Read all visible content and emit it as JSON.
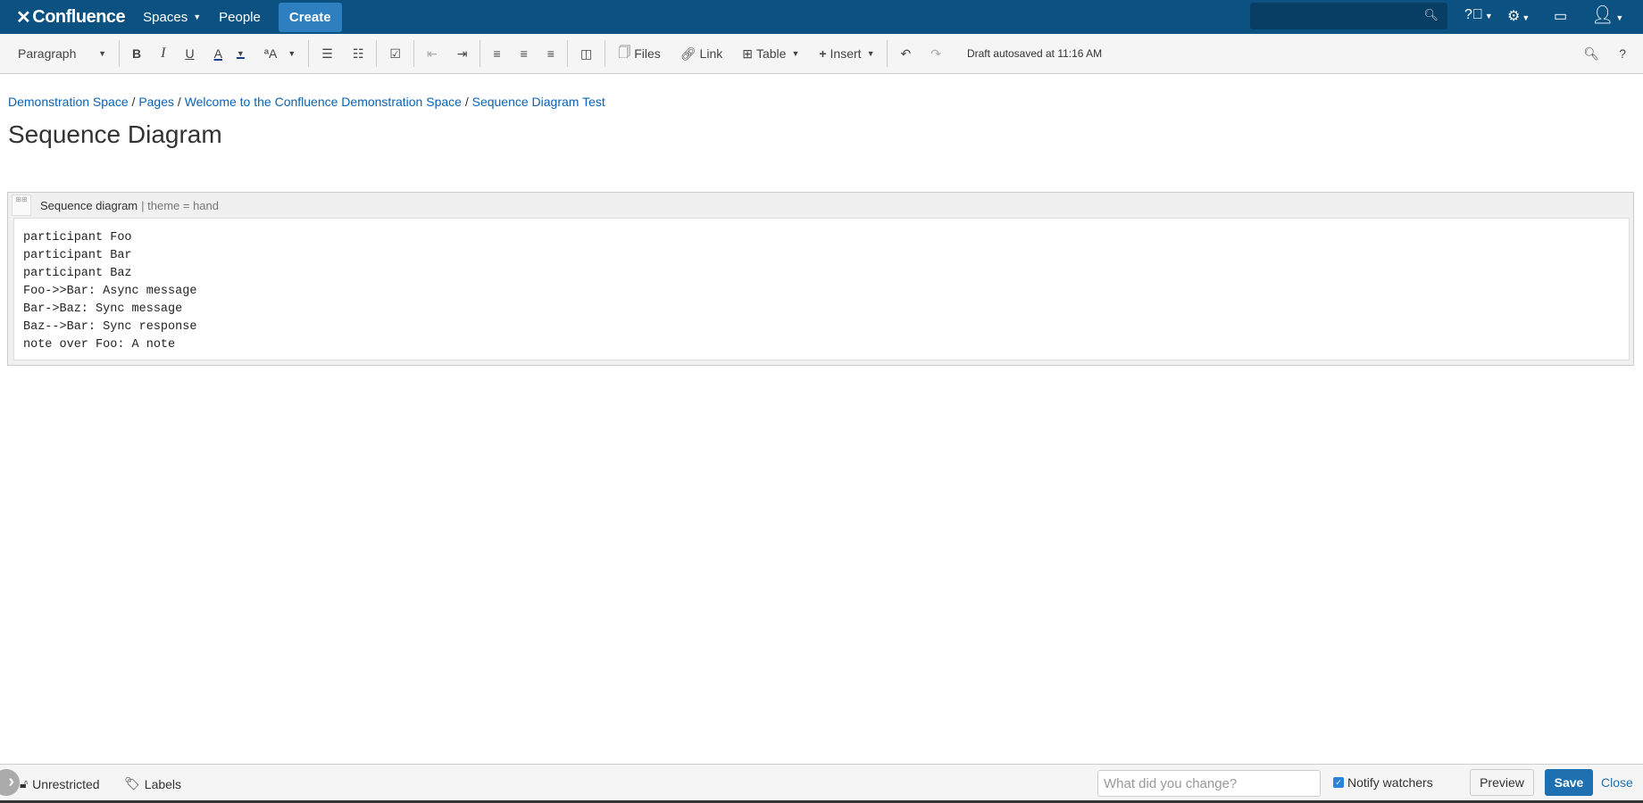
{
  "header": {
    "logo": "Confluence",
    "spaces": "Spaces",
    "people": "People",
    "create": "Create"
  },
  "toolbar": {
    "paragraph": "Paragraph",
    "bold": "B",
    "italic": "I",
    "underline": "U",
    "color": "A",
    "files": "Files",
    "link": "Link",
    "table": "Table",
    "insert": "Insert",
    "draft": "Draft autosaved at 11:16 AM",
    "help": "?"
  },
  "breadcrumb": [
    "Demonstration Space",
    "Pages",
    "Welcome to the Confluence Demonstration Space",
    "Sequence Diagram Test"
  ],
  "page": {
    "title": "Sequence Diagram"
  },
  "macro": {
    "name": "Sequence diagram",
    "params": "| theme = hand",
    "body": "participant Foo\nparticipant Bar\nparticipant Baz\nFoo->>Bar: Async message\nBar->Baz: Sync message\nBaz-->Bar: Sync response\nnote over Foo: A note"
  },
  "footer": {
    "restrictions": "Unrestricted",
    "labels": "Labels",
    "message_placeholder": "What did you change?",
    "notify": "Notify watchers",
    "preview": "Preview",
    "save": "Save",
    "close": "Close"
  }
}
